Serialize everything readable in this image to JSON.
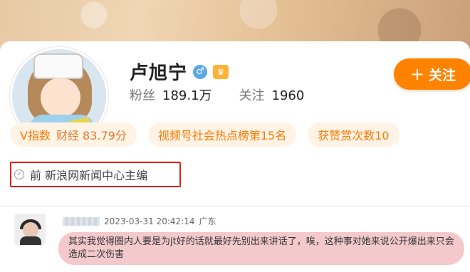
{
  "profile": {
    "name": "卢旭宁",
    "verified_badge": "V",
    "gender_icon": "male-icon",
    "crown_icon": "crown-icon",
    "fans_label": "粉丝",
    "fans_value": "189.1万",
    "following_label": "关注",
    "following_value": "1960",
    "follow_button": {
      "plus": "+",
      "label": "关注"
    }
  },
  "tags": [
    {
      "label": "V指数",
      "sub": "财经 83.79分"
    },
    {
      "label": "视频号社会热点榜第15名"
    },
    {
      "label": "获赞赏次数10"
    }
  ],
  "verification": {
    "icon": "check-circle-icon",
    "text": "前 新浪网新闻中心主编"
  },
  "comment": {
    "timestamp": "2023-03-31 20:42:14",
    "location": "广东",
    "text": "其实我觉得圈内人要是为jt好的话就最好先别出来讲话了，唉，这种事对她来说公开爆出来只会造成二次伤害"
  },
  "colors": {
    "accent": "#ff8200",
    "tag_bg": "#fff3e6",
    "highlight_box": "#e0201b",
    "comment_bg": "#f4c9cc"
  }
}
